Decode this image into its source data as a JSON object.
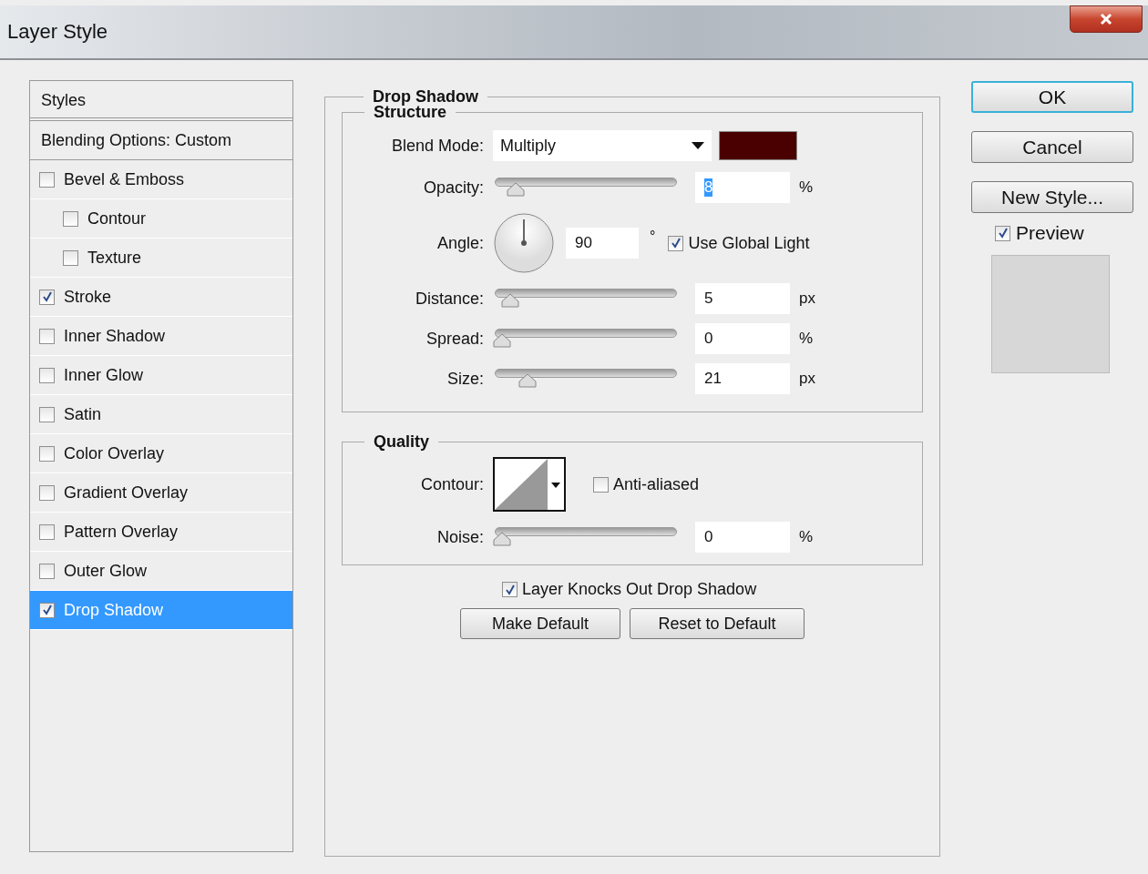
{
  "window": {
    "title": "Layer Style"
  },
  "styles_panel": {
    "header": "Styles",
    "items": [
      {
        "kind": "option",
        "label": "Blending Options: Custom",
        "selected": false
      },
      {
        "kind": "effect",
        "label": "Bevel & Emboss",
        "checked": false,
        "selected": false,
        "children": [
          {
            "kind": "effect",
            "label": "Contour",
            "checked": false,
            "selected": false
          },
          {
            "kind": "effect",
            "label": "Texture",
            "checked": false,
            "selected": false
          }
        ]
      },
      {
        "kind": "effect",
        "label": "Stroke",
        "checked": true,
        "selected": false
      },
      {
        "kind": "effect",
        "label": "Inner Shadow",
        "checked": false,
        "selected": false
      },
      {
        "kind": "effect",
        "label": "Inner Glow",
        "checked": false,
        "selected": false
      },
      {
        "kind": "effect",
        "label": "Satin",
        "checked": false,
        "selected": false
      },
      {
        "kind": "effect",
        "label": "Color Overlay",
        "checked": false,
        "selected": false
      },
      {
        "kind": "effect",
        "label": "Gradient Overlay",
        "checked": false,
        "selected": false
      },
      {
        "kind": "effect",
        "label": "Pattern Overlay",
        "checked": false,
        "selected": false
      },
      {
        "kind": "effect",
        "label": "Outer Glow",
        "checked": false,
        "selected": false
      },
      {
        "kind": "effect",
        "label": "Drop Shadow",
        "checked": true,
        "selected": true
      }
    ]
  },
  "drop_shadow": {
    "title": "Drop Shadow",
    "structure": {
      "title": "Structure",
      "rows": [
        {
          "kind": "dropdown",
          "label": "Blend Mode:",
          "value": "Multiply",
          "color": "#4a0000"
        },
        {
          "kind": "slider",
          "label": "Opacity:",
          "level": 0.08,
          "value": "8",
          "text_selected": true,
          "unit": "%"
        },
        {
          "kind": "angle",
          "label": "Angle:",
          "value": "90",
          "unit": "°",
          "checkbox": {
            "label": "Use Global Light",
            "checked": true
          }
        },
        {
          "kind": "slider",
          "label": "Distance:",
          "level": 0.05,
          "value": "5",
          "text_selected": false,
          "unit": "px"
        },
        {
          "kind": "slider",
          "label": "Spread:",
          "level": 0,
          "value": "0",
          "text_selected": false,
          "unit": "%"
        },
        {
          "kind": "slider",
          "label": "Size:",
          "level": 0.15,
          "value": "21",
          "text_selected": false,
          "unit": "px"
        }
      ]
    },
    "quality": {
      "title": "Quality",
      "contour_label": "Contour:",
      "anti_aliased": {
        "label": "Anti-aliased",
        "checked": false
      },
      "noise": {
        "label": "Noise:",
        "level": 0,
        "value": "0",
        "unit": "%"
      }
    },
    "knockout": {
      "label": "Layer Knocks Out Drop Shadow",
      "checked": true
    },
    "buttons": [
      "Make Default",
      "Reset to Default"
    ]
  },
  "side": {
    "buttons": [
      {
        "label": "OK",
        "default": true
      },
      {
        "label": "Cancel",
        "default": false
      },
      {
        "label": "New Style...",
        "default": false
      }
    ],
    "preview": {
      "label": "Preview",
      "checked": true
    }
  }
}
